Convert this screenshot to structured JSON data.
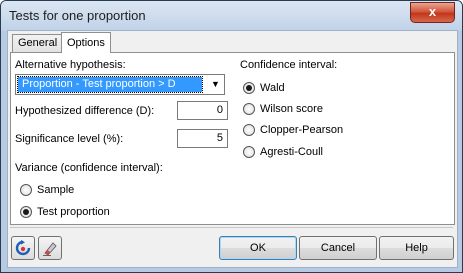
{
  "window": {
    "title": "Tests for one proportion",
    "close_label": "x"
  },
  "tabs": [
    {
      "label": "General"
    },
    {
      "label": "Options"
    }
  ],
  "options": {
    "alt_hypothesis_label": "Alternative hypothesis:",
    "alt_hypothesis_value": "Proportion - Test proportion > D",
    "hyp_diff_label": "Hypothesized difference (D):",
    "hyp_diff_value": "0",
    "sig_level_label": "Significance level (%):",
    "sig_level_value": "5",
    "variance_label": "Variance (confidence interval):",
    "variance_options": [
      {
        "label": "Sample",
        "selected": false
      },
      {
        "label": "Test proportion",
        "selected": true
      }
    ],
    "ci_label": "Confidence interval:",
    "ci_options": [
      {
        "label": "Wald",
        "selected": true
      },
      {
        "label": "Wilson score",
        "selected": false
      },
      {
        "label": "Clopper-Pearson",
        "selected": false
      },
      {
        "label": "Agresti-Coull",
        "selected": false
      }
    ]
  },
  "buttons": {
    "ok": "OK",
    "cancel": "Cancel",
    "help": "Help"
  },
  "icons": {
    "reset": "reset-icon",
    "eraser": "eraser-icon"
  },
  "colors": {
    "selection": "#3399ff",
    "title_bg": "#c0d2e8",
    "close": "#c2361a"
  }
}
